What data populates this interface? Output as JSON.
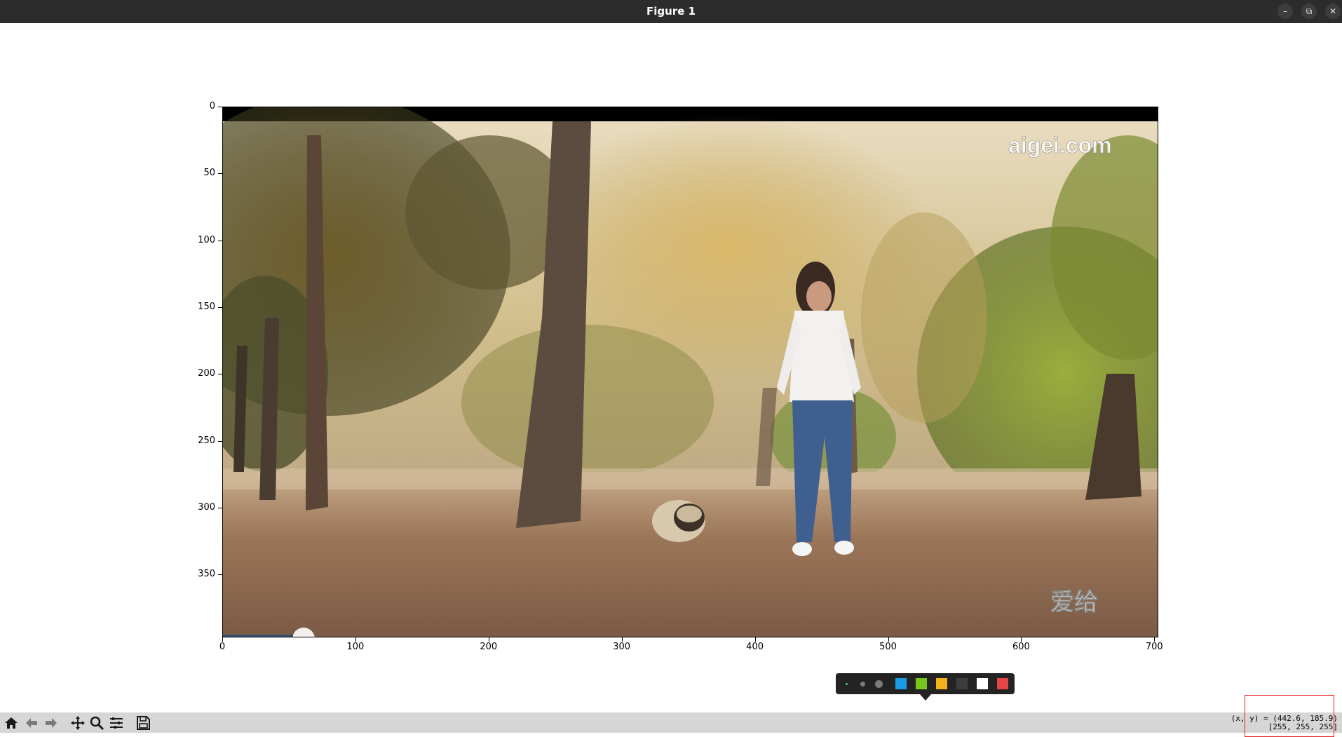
{
  "window": {
    "title": "Figure 1",
    "minimize_glyph": "–",
    "restore_glyph": "⧉",
    "close_glyph": "✕"
  },
  "plot": {
    "type": "image",
    "xticks": [
      "0",
      "100",
      "200",
      "300",
      "400",
      "500",
      "600",
      "700"
    ],
    "yticks": [
      "0",
      "50",
      "100",
      "150",
      "200",
      "250",
      "300",
      "350"
    ],
    "xlim": [
      0,
      703
    ],
    "ylim": [
      397,
      0
    ],
    "watermark_top": "aigei.com",
    "watermark_bottom": "爱给"
  },
  "palette": {
    "swatches": [
      "#1a9be6",
      "#7ac51c",
      "#f2b21a",
      "#3d3d3d",
      "#ffffff",
      "#e64545"
    ],
    "dot_sizes": [
      "small",
      "medium",
      "large"
    ]
  },
  "toolbar": {
    "buttons": [
      "home-icon",
      "back-icon",
      "forward-icon",
      "pan-icon",
      "zoom-icon",
      "configure-icon",
      "save-icon"
    ]
  },
  "status": {
    "coords": "(x, y) = (442.6, 185.9)",
    "pixel": "[255, 255, 255]"
  }
}
